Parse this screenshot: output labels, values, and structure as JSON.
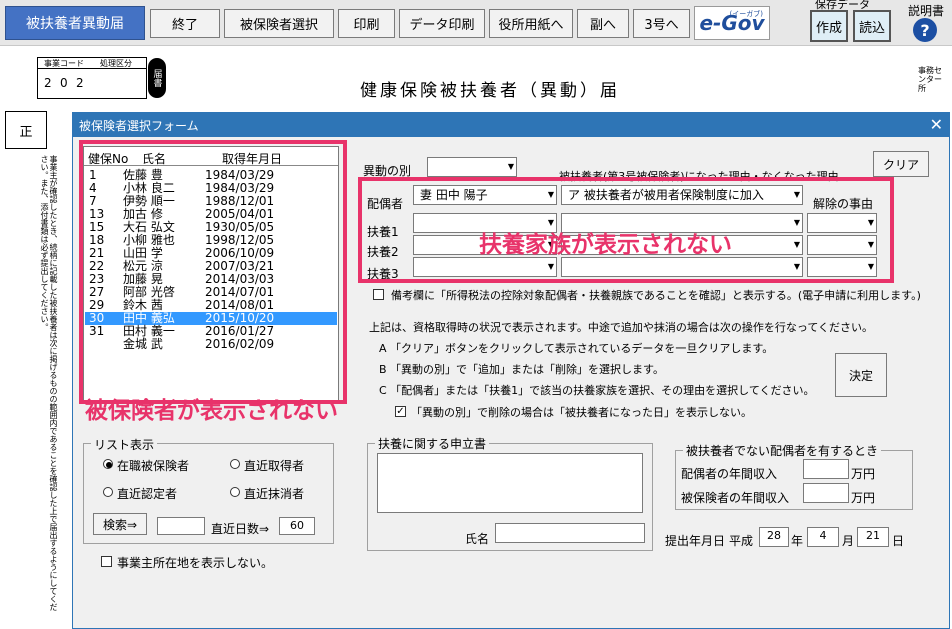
{
  "toolbar": {
    "title": "被扶養者異動届",
    "buttons": [
      "終了",
      "被保険者選択",
      "印刷",
      "データ印刷",
      "役所用紙へ",
      "副へ",
      "3号へ"
    ],
    "egov": "e-Gov",
    "egov_sub": "(イーガブ)",
    "save_label": "保存データ",
    "create": "作成",
    "load": "読込",
    "help_label": "説明書",
    "help_icon": "?"
  },
  "document": {
    "title": "健康保険被扶養者（異動）届",
    "code_label": "事業コード",
    "class_label": "処理区分",
    "code_digits": [
      "2",
      "0",
      "2"
    ],
    "stamp": "届書",
    "mark": "正",
    "right_label": "事務センター所",
    "vertical_note": "事業主が確認したとき、続柄に記載した被扶養者は次に掲げるものの範囲内であることを確認した上で届出するようにしてください。また、添付書類は必ず提出してください。"
  },
  "dialog": {
    "title": "被保険者選択フォーム",
    "close": "✕",
    "list_headers": [
      "健保No",
      "氏名",
      "取得年月日"
    ],
    "rows": [
      {
        "no": "1",
        "name": "佐藤 豊",
        "date": "1984/03/29"
      },
      {
        "no": "4",
        "name": "小林 良二",
        "date": "1984/03/29"
      },
      {
        "no": "7",
        "name": "伊勢 順一",
        "date": "1988/12/01"
      },
      {
        "no": "13",
        "name": "加古 修",
        "date": "2005/04/01"
      },
      {
        "no": "15",
        "name": "大石 弘文",
        "date": "1930/05/05"
      },
      {
        "no": "18",
        "name": "小柳 雅也",
        "date": "1998/12/05"
      },
      {
        "no": "21",
        "name": "山田 学",
        "date": "2006/10/09"
      },
      {
        "no": "22",
        "name": "松元 涼",
        "date": "2007/03/21"
      },
      {
        "no": "23",
        "name": "加藤 晃",
        "date": "2014/03/03"
      },
      {
        "no": "27",
        "name": "阿部 光啓",
        "date": "2014/07/01"
      },
      {
        "no": "29",
        "name": "鈴木 茜",
        "date": "2014/08/01"
      },
      {
        "no": "30",
        "name": "田中 義弘",
        "date": "2015/10/20"
      },
      {
        "no": "31",
        "name": "田村 義一",
        "date": "2016/01/27"
      },
      {
        "no": "",
        "name": "金城 武",
        "date": "2016/02/09"
      }
    ],
    "selected_index": 11,
    "list_display": {
      "label": "リスト表示",
      "options": [
        "在職被保険者",
        "直近取得者",
        "直近認定者",
        "直近抹消者"
      ],
      "selected": 0,
      "search": "検索⇒",
      "days_label": "直近日数⇒",
      "days": "60"
    },
    "show_address": "事業主所在地を表示しない。",
    "idou_label": "異動の別",
    "reason_header": "被扶養者(第3号被保険者)になった理由・なくなった理由",
    "clear": "クリア",
    "spouse_label": "配偶者",
    "spouse_value": "妻 田中 陽子",
    "spouse_reason": "ア 被扶養者が被用者保険制度に加入",
    "cancel_reason": "解除の事由",
    "dependents": [
      "扶養1",
      "扶養2",
      "扶養3"
    ],
    "note_checkbox": "備考欄に「所得税法の控除対象配偶者・扶養親族であることを確認」と表示する。(電子申請に利用します。)",
    "instructions": [
      "上記は、資格取得時の状況で表示されます。中途で追加や抹消の場合は次の操作を行なってください。",
      "A 「クリア」ボタンをクリックして表示されているデータを一旦クリアします。",
      "B 「異動の別」で「追加」または「削除」を選択します。",
      "C 「配偶者」または「扶養1」で該当の扶養家族を選択、その理由を選択してください。"
    ],
    "delete_note": "「異動の別」で削除の場合は「被扶養者になった日」を表示しない。",
    "decide": "決定",
    "statement_label": "扶養に関する申立書",
    "name_label": "氏名",
    "income_group": "被扶養者でない配偶者を有するとき",
    "spouse_income": "配偶者の年間収入",
    "insured_income": "被保険者の年間収入",
    "yen": "万円",
    "submit_label": "提出年月日",
    "era": "平成",
    "year": "28",
    "month": "4",
    "day": "21",
    "y": "年",
    "m": "月",
    "d": "日"
  },
  "annotations": {
    "dependents_missing": "扶養家族が表示されない",
    "insured_missing": "被保険者が表示されない"
  },
  "colors": {
    "accent": "#2e75b6",
    "highlight": "#e8336a",
    "title_button": "#4472c4",
    "selection": "#3399ff"
  }
}
